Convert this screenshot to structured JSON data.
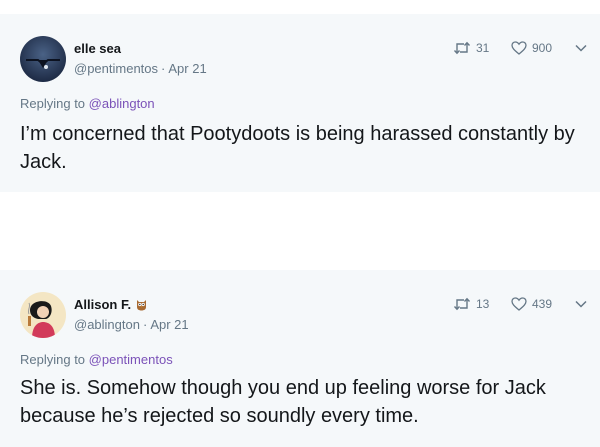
{
  "tweets": [
    {
      "display_name": "elle sea",
      "handle": "@pentimentos",
      "separator": "·",
      "date": "Apr 21",
      "replying_prefix": "Replying to",
      "replying_to": "@ablington",
      "text": "I’m concerned that Pootydoots is being harassed constantly by Jack.",
      "retweets": "31",
      "likes": "900",
      "avatar_icon": "moon-night-avatar",
      "retweet_icon": "retweet-icon",
      "like_icon": "heart-icon",
      "more_icon": "chevron-down-icon"
    },
    {
      "display_name": "Allison F.",
      "handle": "@ablington",
      "separator": "·",
      "date": "Apr 21",
      "replying_prefix": "Replying to",
      "replying_to": "@pentimentos",
      "text": "She is. Somehow though you end up feeling worse for Jack because he’s rejected so soundly every time.",
      "retweets": "13",
      "likes": "439",
      "avatar_icon": "illustrated-woman-avatar",
      "badge_icon": "owl-emoji-icon",
      "retweet_icon": "retweet-icon",
      "like_icon": "heart-icon",
      "more_icon": "chevron-down-icon"
    }
  ],
  "colors": {
    "background": "#f5f8fa",
    "text": "#14171a",
    "secondary_text": "#657786",
    "mention": "#7b52b8"
  }
}
